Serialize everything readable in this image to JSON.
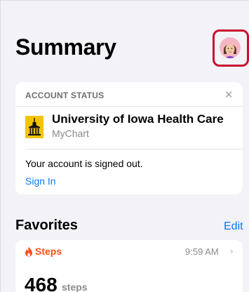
{
  "header": {
    "title": "Summary"
  },
  "account_status": {
    "header": "ACCOUNT STATUS",
    "close_icon": "✕",
    "org_name": "University of Iowa Health Care",
    "app_name": "MyChart",
    "message": "Your account is signed out.",
    "action": "Sign In"
  },
  "favorites": {
    "title": "Favorites",
    "edit_label": "Edit",
    "steps": {
      "label": "Steps",
      "time": "9:59 AM",
      "chevron": "›",
      "value": "468",
      "unit": "steps"
    }
  },
  "colors": {
    "accent": "#0a7aff",
    "highlight": "#c8102e",
    "steps": "#ff4f1a",
    "logo": "#f5c400"
  }
}
